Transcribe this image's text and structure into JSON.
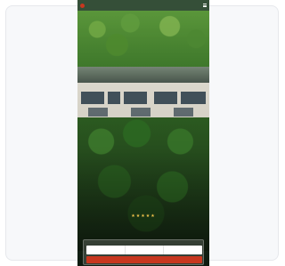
{
  "brand": {
    "accent_color": "#c8371f"
  },
  "topbar": {
    "nav_items": [
      "",
      "",
      "",
      ""
    ]
  },
  "hero": {
    "stars": "★★★★★",
    "headline": "",
    "subline": ""
  },
  "booking": {
    "title": "",
    "link": "",
    "fields": [
      {
        "label": "",
        "value": ""
      },
      {
        "label": "",
        "value": ""
      },
      {
        "label": "",
        "value": ""
      }
    ],
    "cta_label": ""
  }
}
